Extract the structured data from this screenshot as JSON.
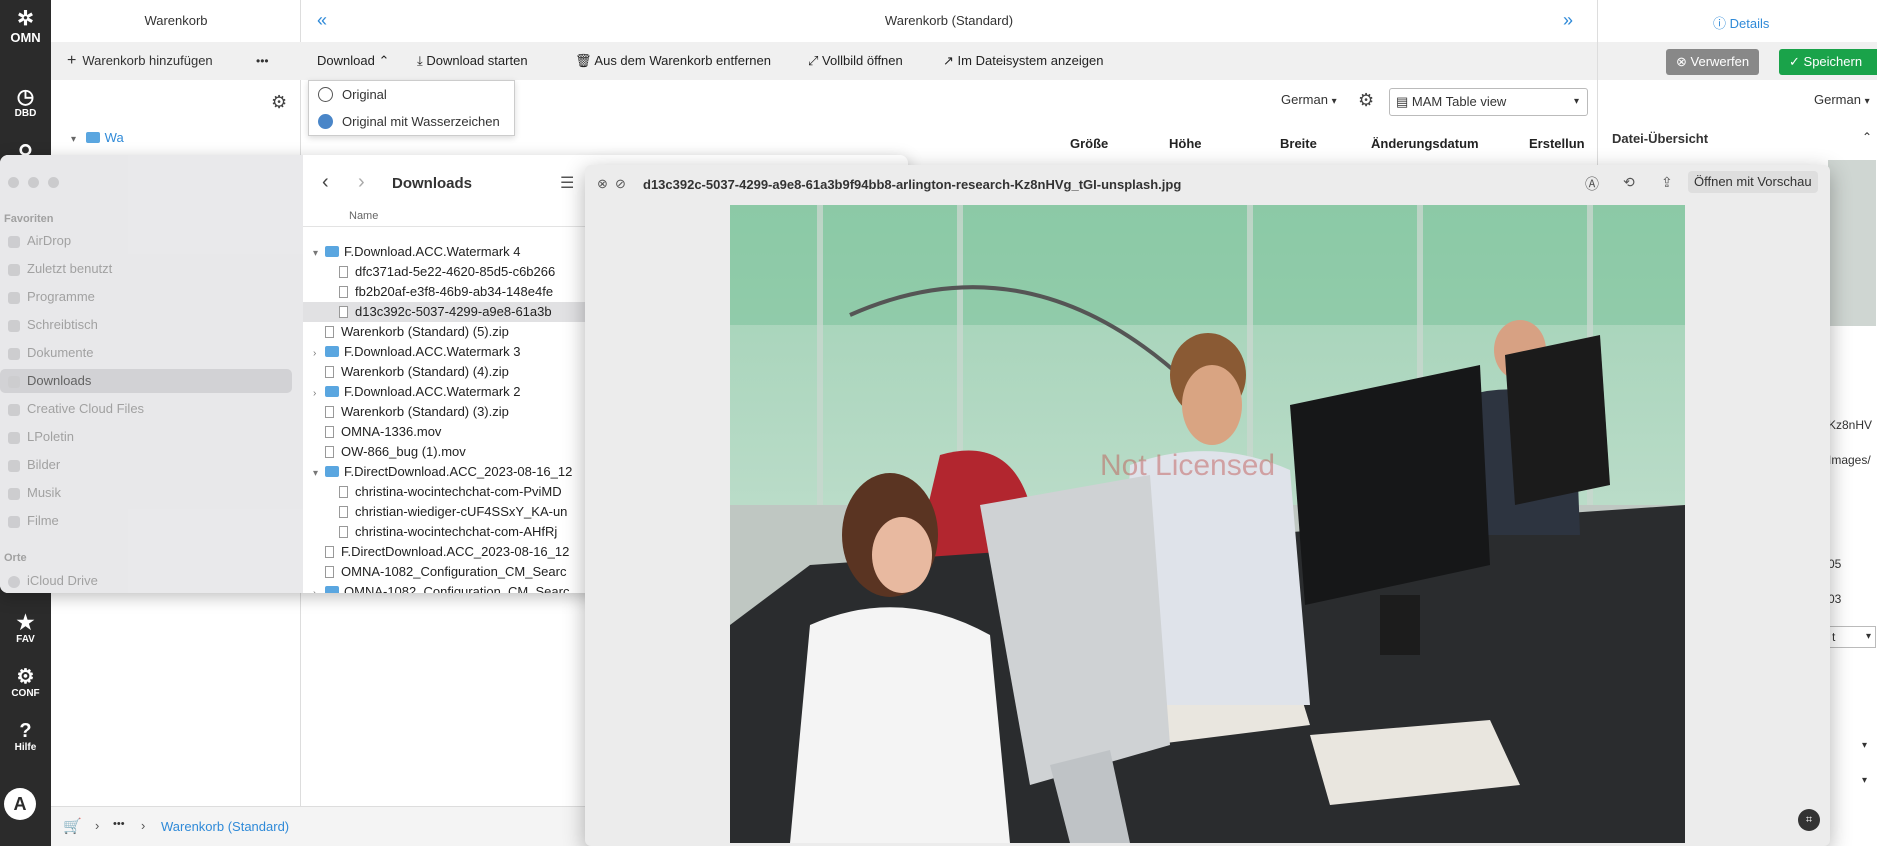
{
  "rail": {
    "logo": "OMN",
    "dbd": "DBD",
    "fav": "FAV",
    "conf": "CONF",
    "hilfe": "Hilfe",
    "avatar": "A"
  },
  "cart": {
    "title": "Warenkorb",
    "add_label": "Warenkorb hinzufügen",
    "more": "•••",
    "tree_item": "Wa"
  },
  "main": {
    "title": "Warenkorb (Standard)",
    "nav_left": "«",
    "nav_right": "»",
    "toolbar": {
      "download": "Download",
      "start": "Download starten",
      "remove": "Aus dem Warenkorb entfernen",
      "fullscreen": "Vollbild öffnen",
      "filesystem": "Im Dateisystem anzeigen"
    },
    "language": "German",
    "view": "MAM Table view",
    "columns": [
      "Größe",
      "Höhe",
      "Breite",
      "Änderungsdatum",
      "Erstellun"
    ]
  },
  "dropdown": {
    "options": [
      "Original",
      "Original mit Wasserzeichen"
    ]
  },
  "details": {
    "title": "Details",
    "discard": "Verwerfen",
    "save": "Speichern",
    "language": "German",
    "overview": "Datei-Übersicht",
    "fragments": [
      "Kz8nHV",
      "Images/",
      "05",
      "03",
      "t"
    ]
  },
  "finder": {
    "title": "Downloads",
    "column_name": "Name",
    "sidebar": {
      "section_favorites": "Favoriten",
      "favorites": [
        "AirDrop",
        "Zuletzt benutzt",
        "Programme",
        "Schreibtisch",
        "Dokumente",
        "Downloads",
        "Creative Cloud Files",
        "LPoletin",
        "Bilder",
        "Musik",
        "Filme"
      ],
      "section_places": "Orte",
      "places": [
        "iCloud Drive"
      ]
    },
    "files": [
      {
        "name": "F.Download.ACC.Watermark 4",
        "kind": "folder",
        "open": true,
        "indent": 0
      },
      {
        "name": "dfc371ad-5e22-4620-85d5-c6b266",
        "kind": "image",
        "indent": 1
      },
      {
        "name": "fb2b20af-e3f8-46b9-ab34-148e4fe",
        "kind": "image",
        "indent": 1
      },
      {
        "name": "d13c392c-5037-4299-a9e8-61a3b",
        "kind": "image",
        "indent": 1
      },
      {
        "name": "Warenkorb (Standard) (5).zip",
        "kind": "zip",
        "indent": 0
      },
      {
        "name": "F.Download.ACC.Watermark 3",
        "kind": "folder",
        "open": false,
        "indent": 0
      },
      {
        "name": "Warenkorb (Standard) (4).zip",
        "kind": "zip",
        "indent": 0
      },
      {
        "name": "F.Download.ACC.Watermark 2",
        "kind": "folder",
        "open": false,
        "indent": 0
      },
      {
        "name": "Warenkorb (Standard) (3).zip",
        "kind": "zip",
        "indent": 0
      },
      {
        "name": "OMNA-1336.mov",
        "kind": "mov",
        "indent": 0
      },
      {
        "name": "OW-866_bug (1).mov",
        "kind": "mov",
        "indent": 0
      },
      {
        "name": "F.DirectDownload.ACC_2023-08-16_12",
        "kind": "folder",
        "open": true,
        "indent": 0
      },
      {
        "name": "christina-wocintechchat-com-PviMD",
        "kind": "image",
        "indent": 1
      },
      {
        "name": "christian-wiediger-cUF4SSxY_KA-un",
        "kind": "image",
        "indent": 1
      },
      {
        "name": "christina-wocintechchat-com-AHfRj",
        "kind": "image",
        "indent": 1
      },
      {
        "name": "F.DirectDownload.ACC_2023-08-16_12",
        "kind": "zip",
        "indent": 0
      },
      {
        "name": "OMNA-1082_Configuration_CM_Searc",
        "kind": "file",
        "indent": 0
      },
      {
        "name": "OMNA-1082_Configuration_CM_Searc",
        "kind": "folder",
        "open": false,
        "indent": 0
      }
    ]
  },
  "quicklook": {
    "filename": "d13c392c-5037-4299-a9e8-61a3b9f94bb8-arlington-research-Kz8nHVg_tGI-unsplash.jpg",
    "open_with": "Öffnen mit Vorschau",
    "watermark": "Not Licensed"
  },
  "bottom": {
    "breadcrumb_more": "•••",
    "breadcrumb_current": "Warenkorb (Standard)"
  }
}
